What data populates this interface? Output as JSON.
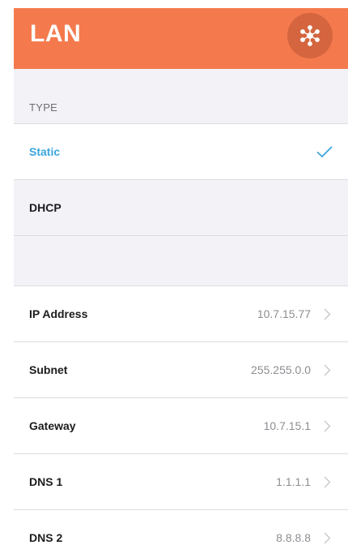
{
  "header": {
    "title": "LAN",
    "action_icon": "network-hub-icon",
    "accent_color": "#f47a4d"
  },
  "type_section": {
    "header": "TYPE",
    "options": [
      {
        "label": "Static",
        "selected": true
      },
      {
        "label": "DHCP",
        "selected": false
      }
    ],
    "selected_color": "#3aa6dc"
  },
  "settings": [
    {
      "label": "IP Address",
      "value": "10.7.15.77"
    },
    {
      "label": "Subnet",
      "value": "255.255.0.0"
    },
    {
      "label": "Gateway",
      "value": "10.7.15.1"
    },
    {
      "label": "DNS 1",
      "value": "1.1.1.1"
    },
    {
      "label": "DNS 2",
      "value": "8.8.8.8"
    }
  ]
}
